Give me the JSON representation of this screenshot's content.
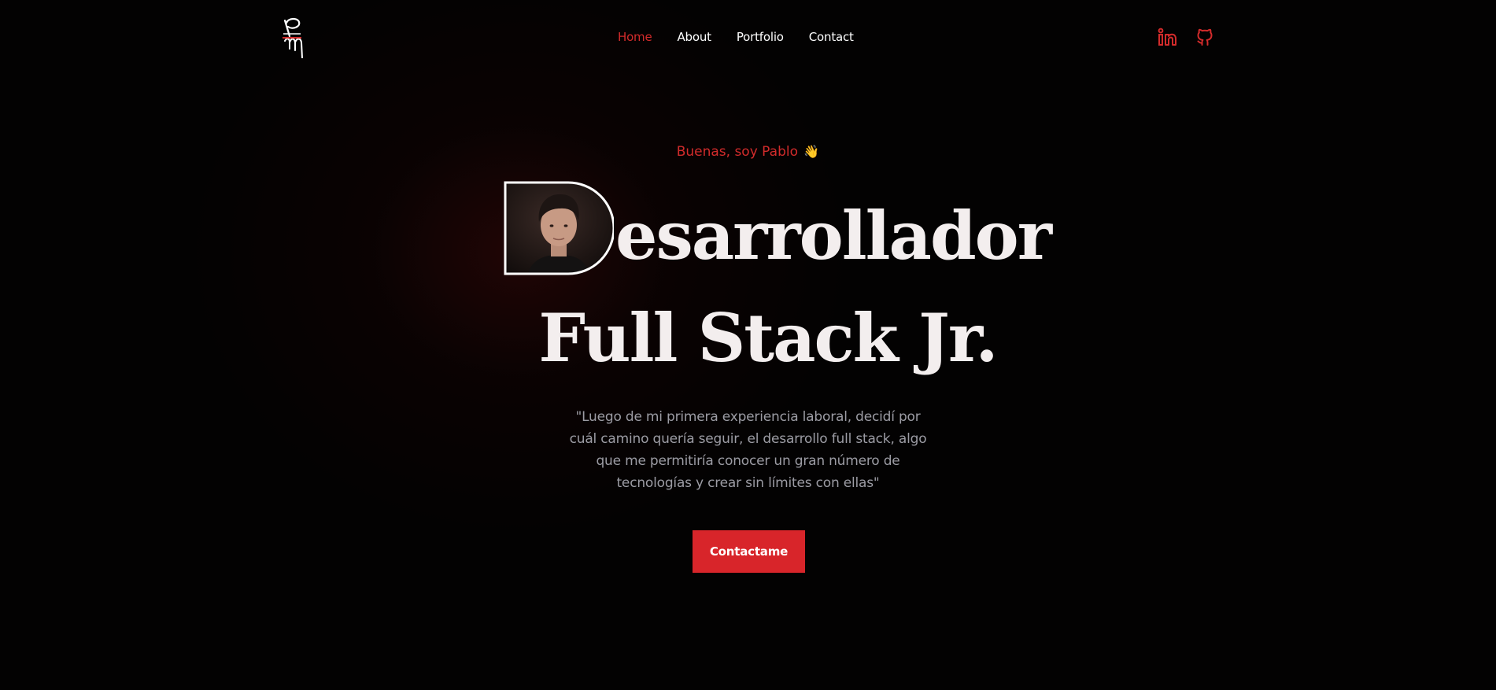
{
  "nav": {
    "items": [
      {
        "label": "Home",
        "active": true
      },
      {
        "label": "About",
        "active": false
      },
      {
        "label": "Portfolio",
        "active": false
      },
      {
        "label": "Contact",
        "active": false
      }
    ]
  },
  "socials": [
    {
      "icon": "linkedin-icon"
    },
    {
      "icon": "github-icon"
    }
  ],
  "hero": {
    "greeting": "Buenas, soy Pablo",
    "greeting_emoji": "👋",
    "headline_line1_rest": "esarrollador",
    "headline_line2": "Full Stack Jr.",
    "quote": "\"Luego de mi primera experiencia laboral, decidí por cuál camino quería seguir, el desarrollo full stack, algo que me permitiría conocer un gran número de tecnologías y crear sin límites con ellas\"",
    "cta_label": "Contactame"
  },
  "colors": {
    "accent": "#d22b2b",
    "button": "#d8252a",
    "background": "#030202",
    "headline": "#f3eeee",
    "quote_text": "#9c9ca4"
  }
}
